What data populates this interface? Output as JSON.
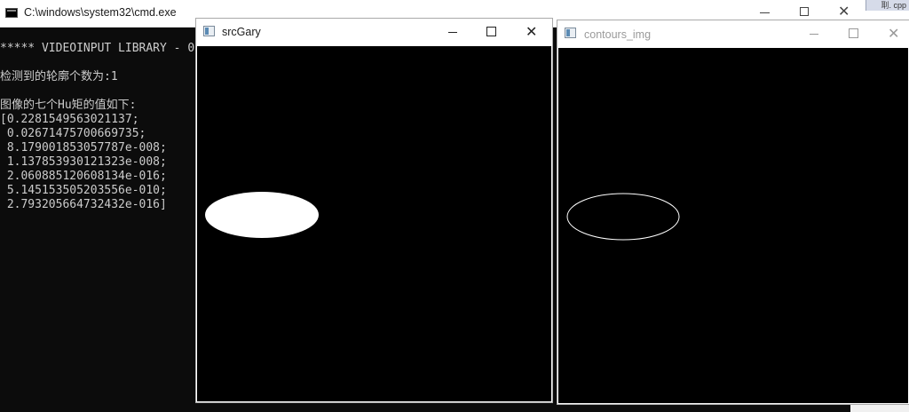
{
  "cmd_window": {
    "title": "C:\\windows\\system32\\cmd.exe",
    "close_glyph": "✕",
    "console_lines": [
      "***** VIDEOINPUT LIBRARY - 0",
      "",
      "检测到的轮廓个数为:1",
      "",
      "图像的七个Hu矩的值如下:",
      "[0.2281549563021137;",
      " 0.02671475700669735;",
      " 8.179001853057787e-008;",
      " 1.137853930121323e-008;",
      " 2.060885120608134e-016;",
      " 5.145153505203556e-010;",
      " 2.793205664732432e-016]"
    ]
  },
  "editor_tab": {
    "label": "刵. cpp"
  },
  "windows": [
    {
      "title": "srcGary",
      "close_glyph": "✕",
      "shape": {
        "type": "filled-ellipse",
        "color": "#ffffff"
      }
    },
    {
      "title": "contours_img",
      "close_glyph": "✕",
      "shape": {
        "type": "ellipse-outline",
        "color": "#ffffff"
      }
    }
  ]
}
